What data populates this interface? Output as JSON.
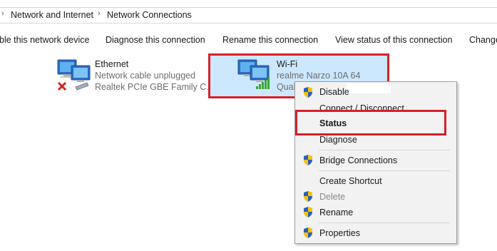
{
  "breadcrumb": {
    "items": [
      "Network and Internet",
      "Network Connections"
    ]
  },
  "command_bar": {
    "disable_label": "ble this network device",
    "diagnose_label": "Diagnose this connection",
    "rename_label": "Rename this connection",
    "view_status_label": "View status of this connection",
    "change_label": "Change"
  },
  "connections": [
    {
      "name": "Ethernet",
      "status": "Network cable unplugged",
      "device": "Realtek PCIe GBE Family C...",
      "icon": "ethernet-disconnected-icon"
    },
    {
      "name": "Wi-Fi",
      "status": "realme Narzo 10A 64",
      "device": "Qual",
      "icon": "wifi-adapter-icon"
    }
  ],
  "context_menu": {
    "items": [
      {
        "label": "Disable",
        "shield": true
      },
      {
        "label": "Connect / Disconnect",
        "shield": false
      },
      {
        "label": "Status",
        "shield": false,
        "bold": true
      },
      {
        "label": "Diagnose",
        "shield": false
      },
      {
        "label": "Bridge Connections",
        "shield": true
      },
      {
        "label": "Create Shortcut",
        "shield": false
      },
      {
        "label": "Delete",
        "shield": true,
        "disabled": true
      },
      {
        "label": "Rename",
        "shield": true
      },
      {
        "label": "Properties",
        "shield": true
      }
    ]
  },
  "colors": {
    "highlight": "#d71f2a",
    "selection": "#cce8ff",
    "menu_bg": "#f2f2f2"
  }
}
